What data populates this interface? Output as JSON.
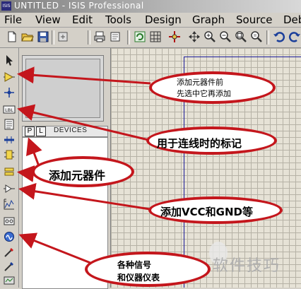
{
  "window": {
    "title": "UNTITLED - ISIS Professional",
    "logo_text": "ISIS"
  },
  "menu": {
    "items": [
      "File",
      "View",
      "Edit",
      "Tools",
      "Design",
      "Graph",
      "Source",
      "Deb"
    ]
  },
  "toolbar": {
    "icons": [
      "new-file-icon",
      "open-folder-icon",
      "save-icon",
      "import-icon",
      "print-icon",
      "print-setup-icon",
      "refresh-icon",
      "grid-icon",
      "origin-icon",
      "pan-icon",
      "zoom-in-icon",
      "zoom-out-icon",
      "zoom-all-icon",
      "zoom-area-icon",
      "undo-icon"
    ]
  },
  "tool_strip": {
    "icons": [
      "select-arrow-icon",
      "component-icon",
      "junction-dot-icon",
      "wire-label-icon",
      "text-script-icon",
      "bus-icon",
      "subcircuit-icon",
      "terminal-icon",
      "device-pin-icon",
      "graph-icon",
      "tape-recorder-icon",
      "generator-icon",
      "voltage-probe-icon",
      "current-probe-icon",
      "virtual-instrument-icon"
    ]
  },
  "panel": {
    "pick_button": "P",
    "library_button": "L",
    "devices_label": "DEVICES"
  },
  "annotations": {
    "pick_first": [
      "添加元器件前",
      "先选中它再添加"
    ],
    "wire_label": "用于连线时的标记",
    "add_component": "添加元器件",
    "add_vcc_gnd": "添加VCC和GND等",
    "signals_instruments": [
      "各种信号",
      "和仪器仪表"
    ]
  },
  "watermark": {
    "text": "软件技巧"
  },
  "colors": {
    "annotation_red": "#c4161c",
    "sheet_border": "#1b1b99",
    "canvas": "#e6e2d6"
  }
}
